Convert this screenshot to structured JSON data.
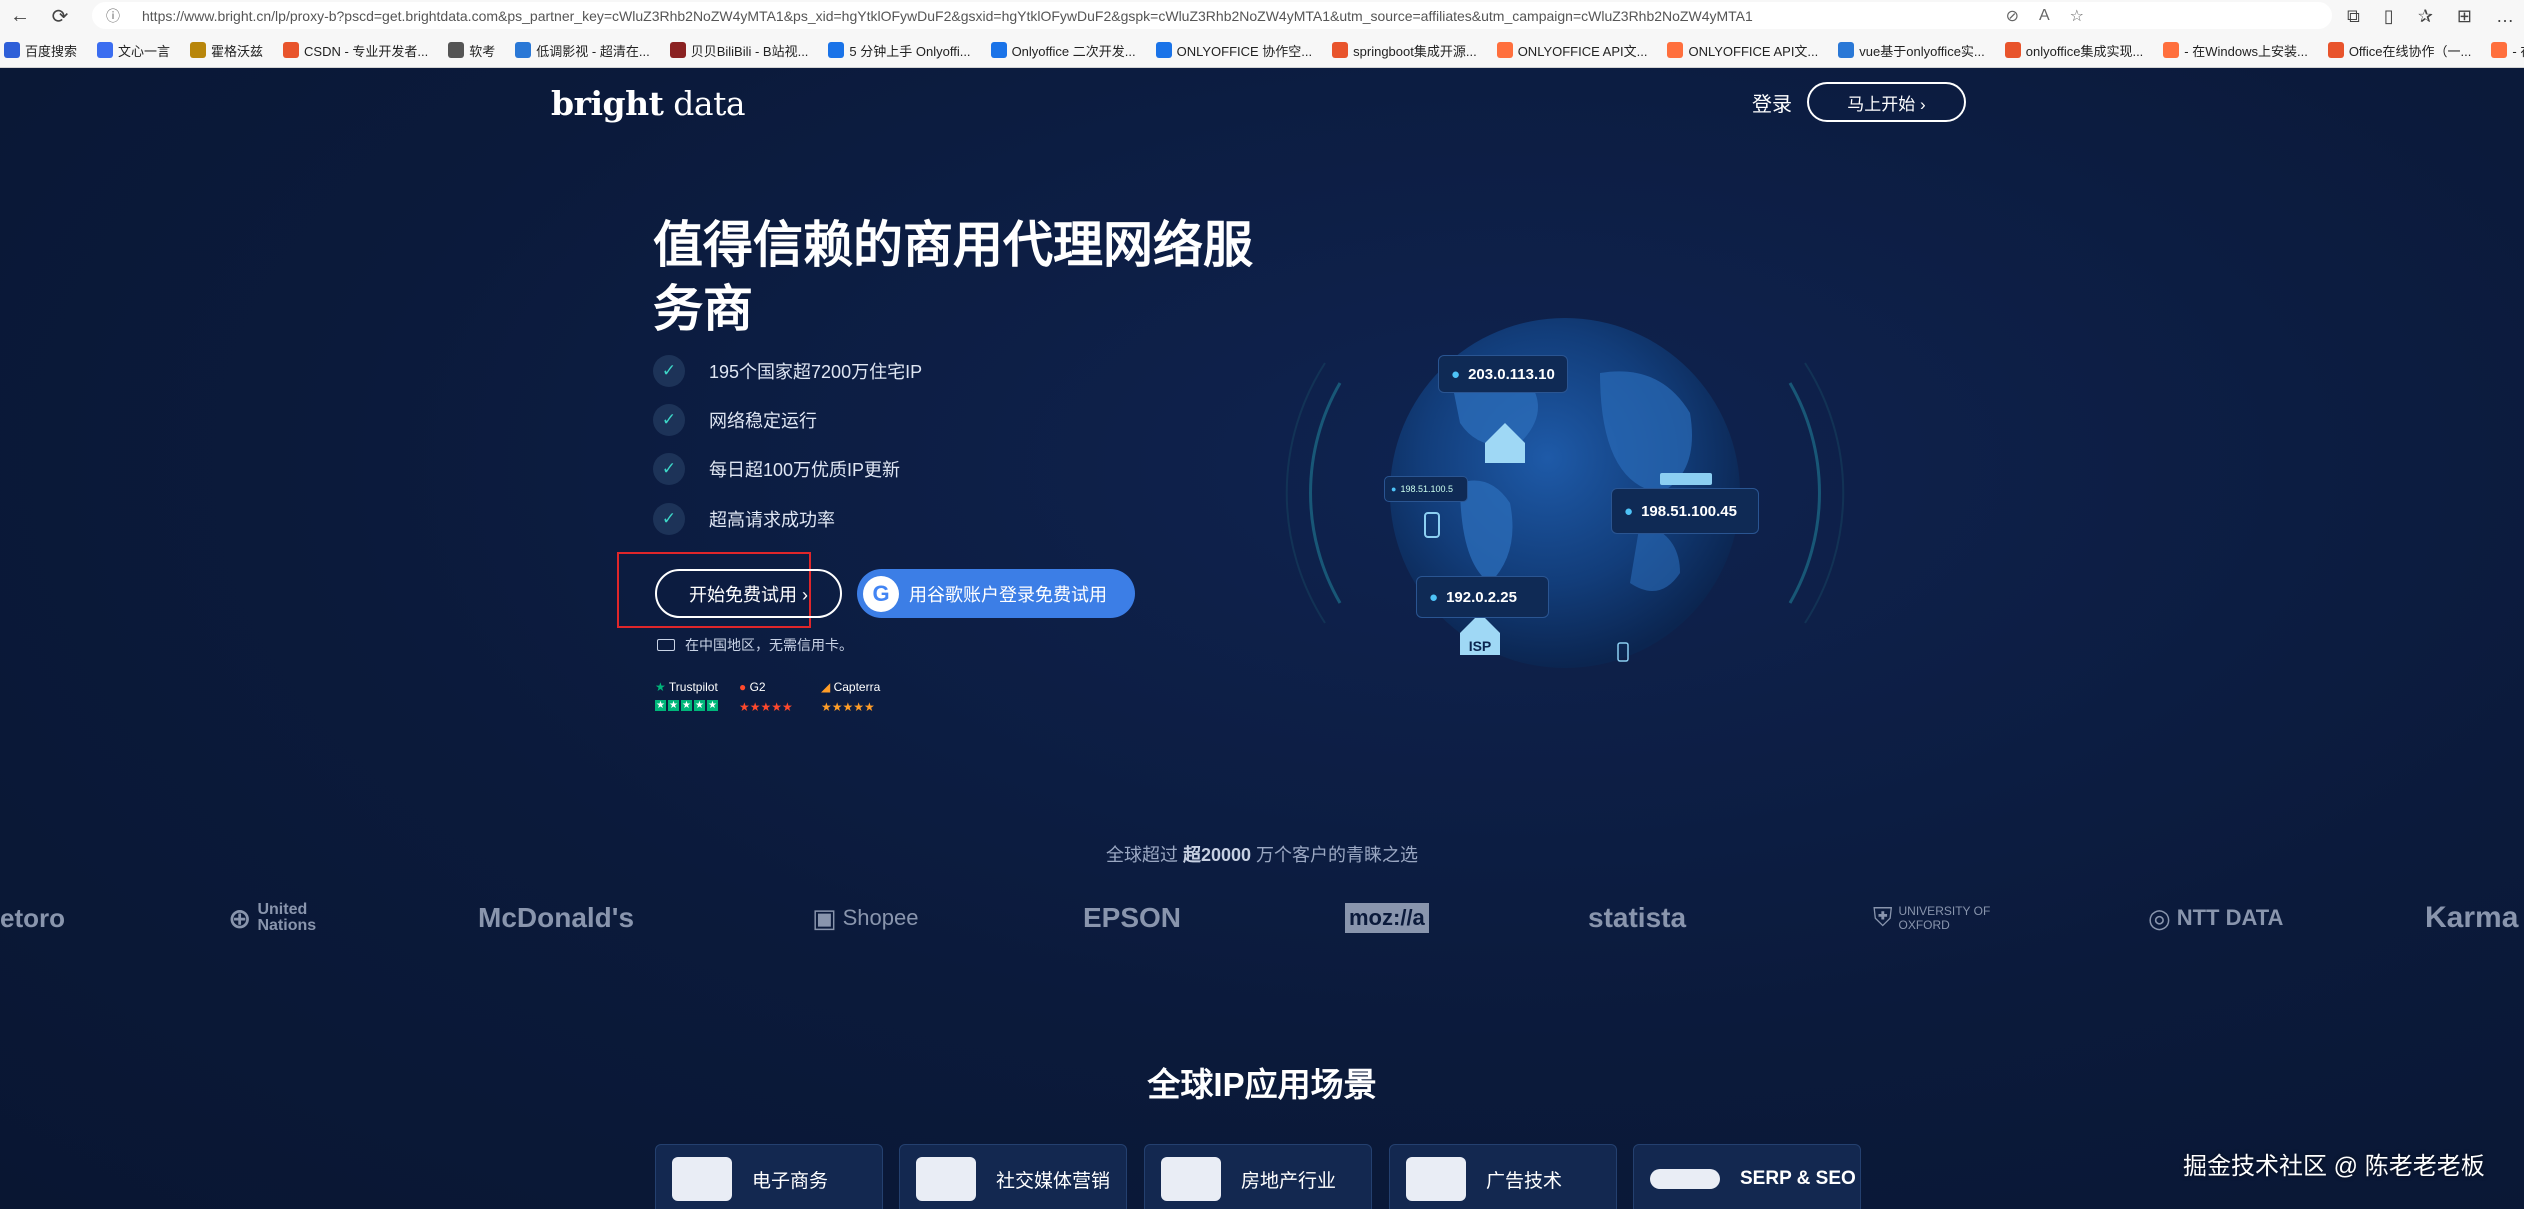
{
  "browser": {
    "url": "https://www.bright.cn/lp/proxy-b?pscd=get.brightdata.com&ps_partner_key=cWluZ3Rhb2NoZW4yMTA1&ps_xid=hgYtklOFywDuF2&gsxid=hgYtklOFywDuF2&gspk=cWluZ3Rhb2NoZW4yMTA1&utm_source=affiliates&utm_campaign=cWluZ3Rhb2NoZW4yMTA1",
    "bookmarks": [
      {
        "label": "百度搜索",
        "icon": "paw-icon",
        "color": "#2e5fd8"
      },
      {
        "label": "文心一言",
        "icon": "ernie-icon",
        "color": "#3b6df0"
      },
      {
        "label": "霍格沃兹",
        "icon": "hogwarts-icon",
        "color": "#b8860b"
      },
      {
        "label": "CSDN - 专业开发者...",
        "icon": "csdn-icon",
        "color": "#e8542c"
      },
      {
        "label": "软考",
        "icon": "folder-icon",
        "color": "#555555"
      },
      {
        "label": "低调影视 - 超清在...",
        "icon": "film-icon",
        "color": "#2a78d6"
      },
      {
        "label": "贝贝BiliBili - B站视...",
        "icon": "bilibili-icon",
        "color": "#8b2222"
      },
      {
        "label": "5 分钟上手 Onlyoffi...",
        "icon": "zhihu-icon",
        "color": "#1a73e8"
      },
      {
        "label": "Onlyoffice 二次开发...",
        "icon": "zhihu-icon",
        "color": "#1a73e8"
      },
      {
        "label": "ONLYOFFICE 协作空...",
        "icon": "zhihu-icon",
        "color": "#1a73e8"
      },
      {
        "label": "springboot集成开源...",
        "icon": "csdn-icon",
        "color": "#e8542c"
      },
      {
        "label": "ONLYOFFICE API文...",
        "icon": "onlyoffice-icon",
        "color": "#ff6f3d"
      },
      {
        "label": "ONLYOFFICE API文...",
        "icon": "onlyoffice-icon",
        "color": "#ff6f3d"
      },
      {
        "label": "vue基于onlyoffice实...",
        "icon": "vue-icon",
        "color": "#2a78d6"
      },
      {
        "label": "onlyoffice集成实现...",
        "icon": "csdn-icon",
        "color": "#e8542c"
      },
      {
        "label": "- 在Windows上安装...",
        "icon": "onlyoffice-icon",
        "color": "#ff6f3d"
      },
      {
        "label": "Office在线协作（一...",
        "icon": "csdn-icon",
        "color": "#e8542c"
      },
      {
        "label": "- 在Windows上安装...",
        "icon": "onlyoffice-icon",
        "color": "#ff6f3d"
      }
    ]
  },
  "header": {
    "logo_bold": "bright",
    "logo_light": " data",
    "login": "登录",
    "start_now": "马上开始 ›"
  },
  "hero": {
    "title": "值得信赖的商用代理网络服务商",
    "features": [
      "195个国家超7200万住宅IP",
      "网络稳定运行",
      "每日超100万优质IP更新",
      "超高请求成功率"
    ],
    "trial_button": "开始免费试用 ›",
    "google_button": "用谷歌账户登录免费试用",
    "card_note": "在中国地区，无需信用卡。",
    "ratings": [
      {
        "name": "Trustpilot",
        "color": "#00b67a"
      },
      {
        "name": "G2",
        "color": "#ff492c"
      },
      {
        "name": "Capterra",
        "color": "#ff9d28"
      }
    ]
  },
  "globe": {
    "ip_tags": [
      "203.0.113.10",
      "198.51.100.45",
      "192.0.2.25",
      "198.51.100.5"
    ],
    "isp_label": "ISP"
  },
  "customers": {
    "prefix": "全球超过 ",
    "count": "超20000",
    "suffix": " 万个客户的青睐之选",
    "logos": [
      "etoro",
      "United Nations",
      "McDonald's",
      "Shopee",
      "EPSON",
      "moz://a",
      "statista",
      "UNIVERSITY OF OXFORD",
      "NTT DATA",
      "Karma"
    ]
  },
  "scenes": {
    "title": "全球IP应用场景",
    "cards": [
      "电子商务",
      "社交媒体营销",
      "房地产行业",
      "广告技术",
      "SERP & SEO"
    ]
  },
  "watermark": "掘金技术社区 @ 陈老老老板"
}
